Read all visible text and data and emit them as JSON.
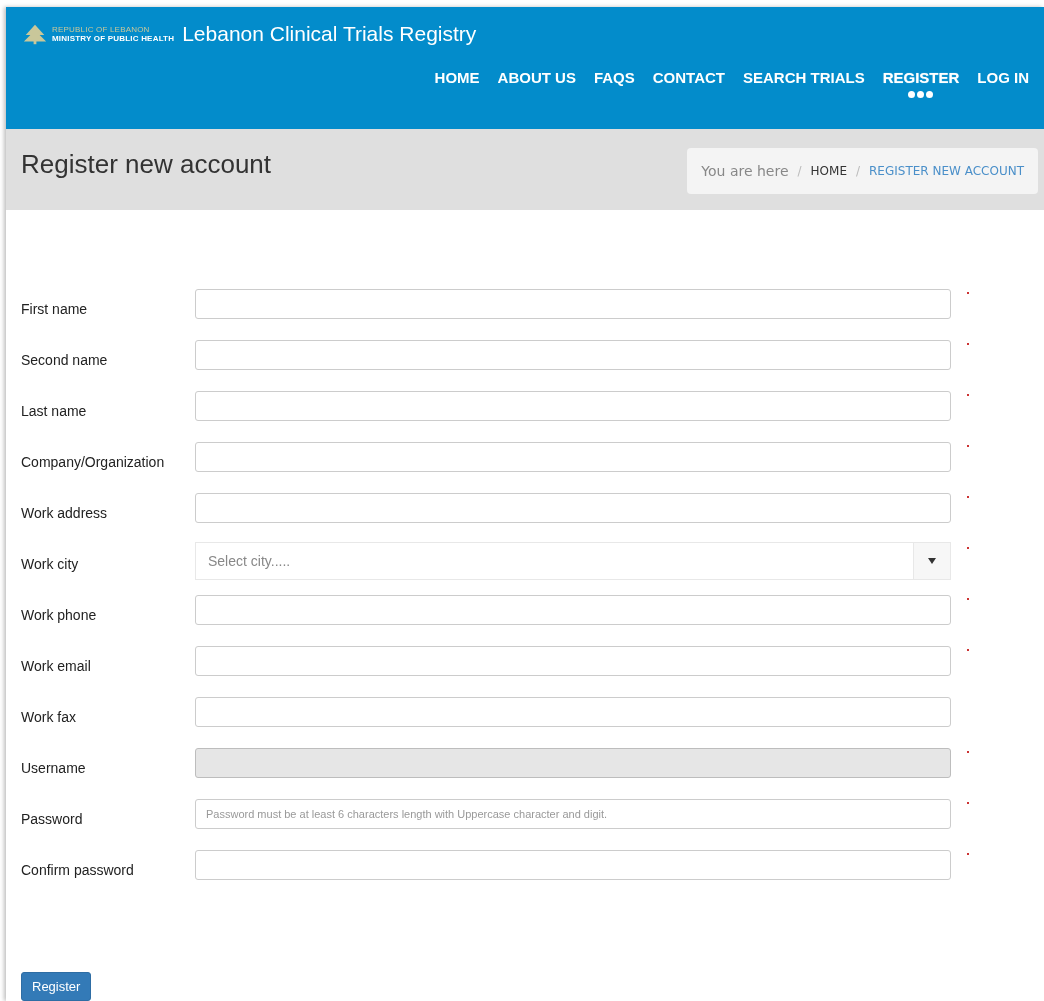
{
  "header": {
    "logo_lines": [
      "REPUBLIC OF LEBANON",
      "MINISTRY OF PUBLIC HEALTH"
    ],
    "title": "Lebanon Clinical Trials Registry"
  },
  "nav": [
    {
      "label": "HOME",
      "selected": false
    },
    {
      "label": "ABOUT US",
      "selected": false
    },
    {
      "label": "FAQS",
      "selected": false
    },
    {
      "label": "CONTACT",
      "selected": false
    },
    {
      "label": "SEARCH TRIALS",
      "selected": false
    },
    {
      "label": "REGISTER",
      "selected": true
    },
    {
      "label": "LOG IN",
      "selected": false
    }
  ],
  "page_title": "Register new account",
  "breadcrumb": {
    "lead": "You are here",
    "items": [
      {
        "separator": "/",
        "label": "HOME",
        "selected": false
      },
      {
        "separator": "/",
        "label": "REGISTER NEW ACCOUNT",
        "selected": true
      }
    ]
  },
  "fields": [
    {
      "label": "First name",
      "kind": "text",
      "required": true,
      "disabled": false
    },
    {
      "label": "Second name",
      "kind": "text",
      "required": true,
      "disabled": false
    },
    {
      "label": "Last name",
      "kind": "text",
      "required": true,
      "disabled": false
    },
    {
      "label": "Company/Organization",
      "kind": "text",
      "required": true,
      "disabled": false
    },
    {
      "label": "Work address",
      "kind": "text",
      "required": true,
      "disabled": false
    },
    {
      "label": "Work city",
      "kind": "select",
      "required": true,
      "placeholder": "Select city....."
    },
    {
      "label": "Work phone",
      "kind": "text",
      "required": true,
      "disabled": false
    },
    {
      "label": "Work email",
      "kind": "text",
      "required": true,
      "disabled": false
    },
    {
      "label": "Work fax",
      "kind": "text",
      "required": false,
      "disabled": false
    },
    {
      "label": "Username",
      "kind": "text",
      "required": true,
      "disabled": true
    },
    {
      "label": "Password",
      "kind": "text",
      "required": true,
      "disabled": false,
      "placeholder": "Password must be at least 6 characters length with Uppercase character and digit."
    },
    {
      "label": "Confirm password",
      "kind": "text",
      "required": true,
      "disabled": false
    }
  ],
  "submit": "Register"
}
